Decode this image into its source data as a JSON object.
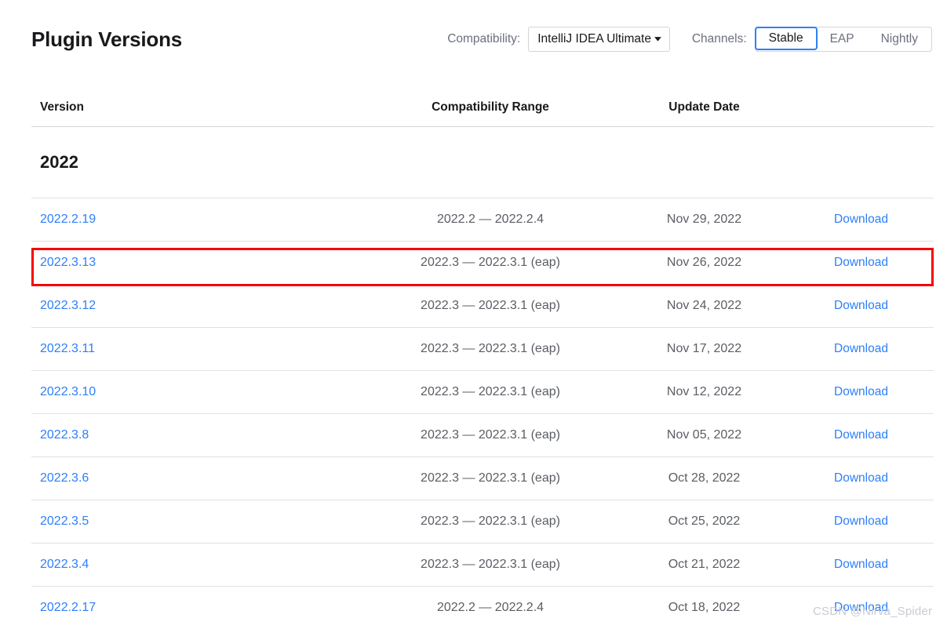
{
  "header": {
    "title": "Plugin Versions",
    "compatibility_label": "Compatibility:",
    "compatibility_value": "IntelliJ IDEA Ultimate",
    "caret_icon": "chevron-down-icon",
    "channels_label": "Channels:",
    "channels": [
      {
        "label": "Stable",
        "active": true
      },
      {
        "label": "EAP",
        "active": false
      },
      {
        "label": "Nightly",
        "active": false
      }
    ]
  },
  "table": {
    "columns": {
      "version": "Version",
      "compatibility_range": "Compatibility Range",
      "update_date": "Update Date",
      "download": ""
    },
    "year_group": "2022",
    "download_label": "Download",
    "rows": [
      {
        "version": "2022.2.19",
        "range": "2022.2 — 2022.2.4",
        "date": "Nov 29, 2022",
        "download": "Download",
        "highlighted": false
      },
      {
        "version": "2022.3.13",
        "range": "2022.3 — 2022.3.1 (eap)",
        "date": "Nov 26, 2022",
        "download": "Download",
        "highlighted": true
      },
      {
        "version": "2022.3.12",
        "range": "2022.3 — 2022.3.1 (eap)",
        "date": "Nov 24, 2022",
        "download": "Download",
        "highlighted": false
      },
      {
        "version": "2022.3.11",
        "range": "2022.3 — 2022.3.1 (eap)",
        "date": "Nov 17, 2022",
        "download": "Download",
        "highlighted": false
      },
      {
        "version": "2022.3.10",
        "range": "2022.3 — 2022.3.1 (eap)",
        "date": "Nov 12, 2022",
        "download": "Download",
        "highlighted": false
      },
      {
        "version": "2022.3.8",
        "range": "2022.3 — 2022.3.1 (eap)",
        "date": "Nov 05, 2022",
        "download": "Download",
        "highlighted": false
      },
      {
        "version": "2022.3.6",
        "range": "2022.3 — 2022.3.1 (eap)",
        "date": "Oct 28, 2022",
        "download": "Download",
        "highlighted": false
      },
      {
        "version": "2022.3.5",
        "range": "2022.3 — 2022.3.1 (eap)",
        "date": "Oct 25, 2022",
        "download": "Download",
        "highlighted": false
      },
      {
        "version": "2022.3.4",
        "range": "2022.3 — 2022.3.1 (eap)",
        "date": "Oct 21, 2022",
        "download": "Download",
        "highlighted": false
      },
      {
        "version": "2022.2.17",
        "range": "2022.2 — 2022.2.4",
        "date": "Oct 18, 2022",
        "download": "Download",
        "highlighted": false
      }
    ]
  },
  "watermark": {
    "text": "CSDN @Nirva_Spider"
  },
  "colors": {
    "link": "#2d7ff9",
    "accent": "#2d7ff9",
    "highlight": "#f70000",
    "text": "#19191c",
    "muted": "#5a5d63",
    "border": "#dfe1e5"
  }
}
